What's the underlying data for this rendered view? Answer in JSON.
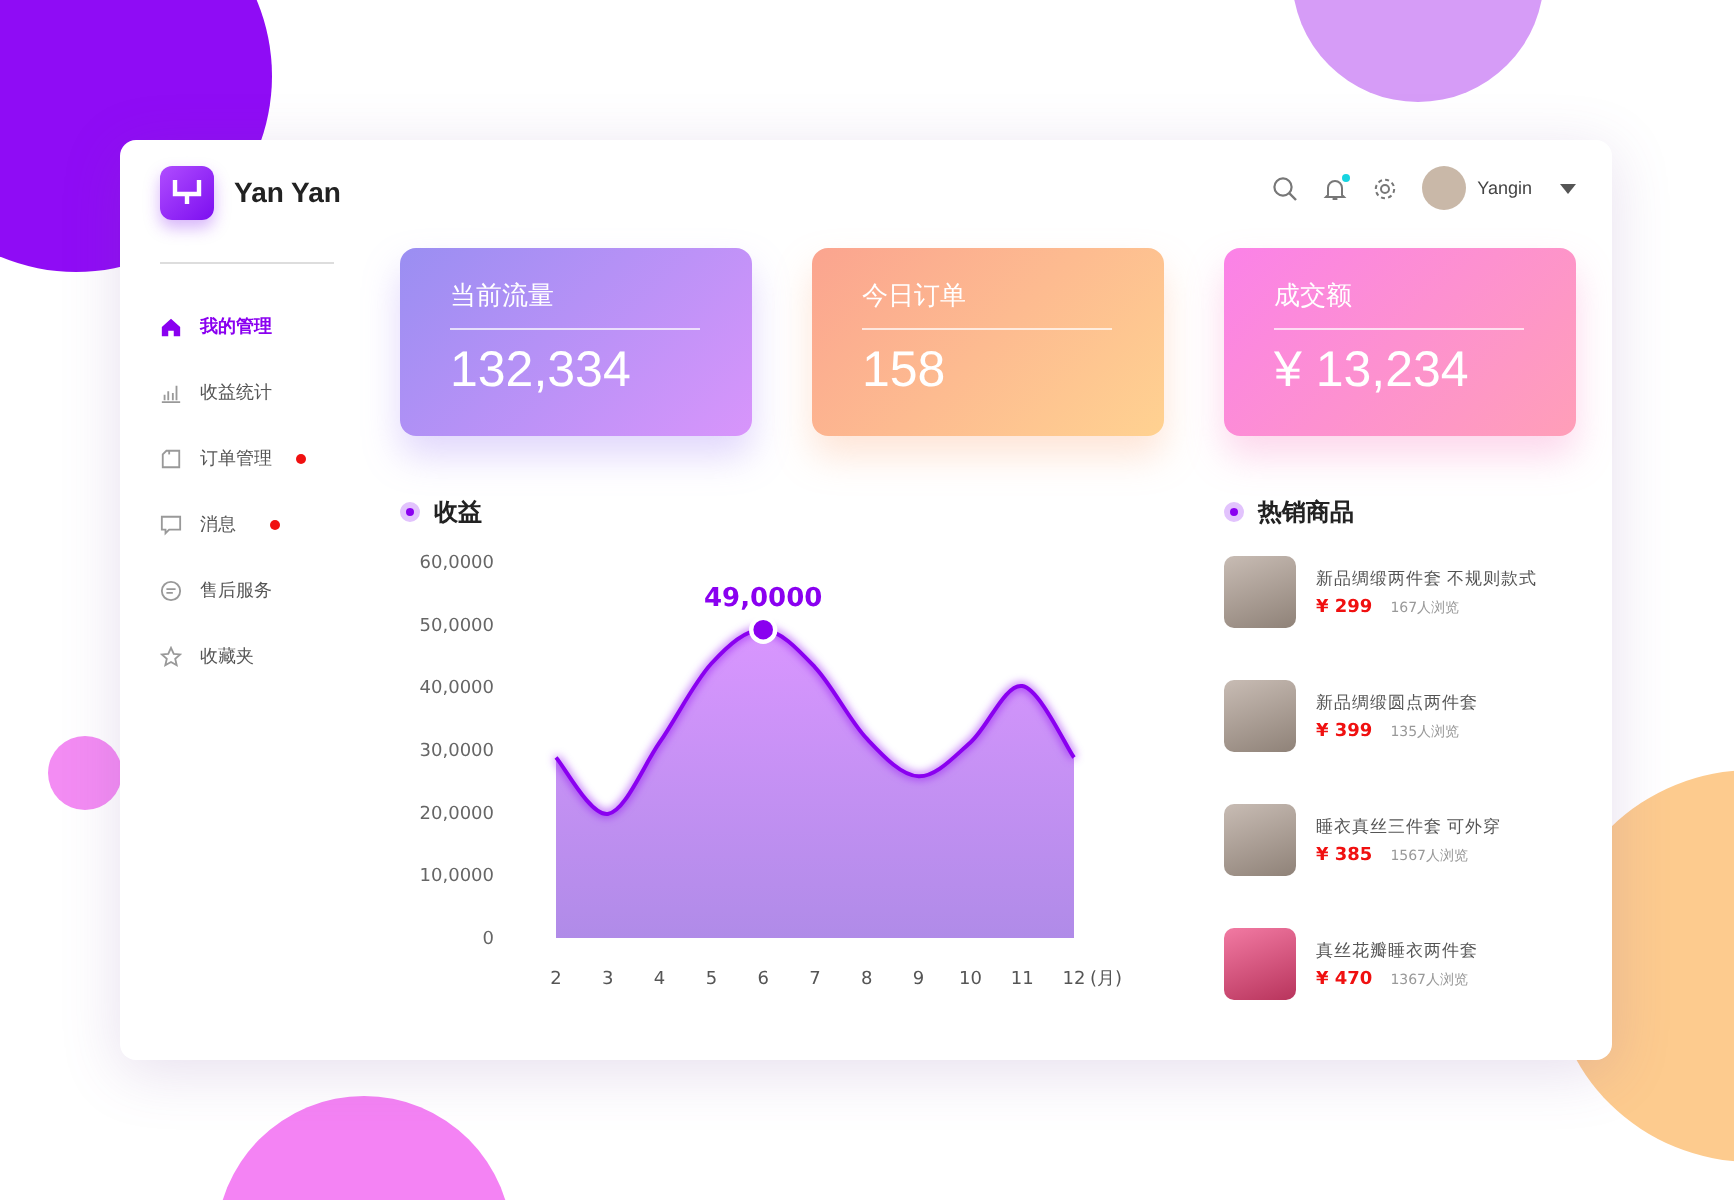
{
  "brand": {
    "name": "Yan Yan"
  },
  "header": {
    "notification_dot": true,
    "user": {
      "name": "Yangin"
    }
  },
  "sidebar": {
    "items": [
      {
        "label": "我的管理",
        "selected": true,
        "badge": false
      },
      {
        "label": "收益统计",
        "selected": false,
        "badge": false
      },
      {
        "label": "订单管理",
        "selected": false,
        "badge": true
      },
      {
        "label": "消息",
        "selected": false,
        "badge": true
      },
      {
        "label": "售后服务",
        "selected": false,
        "badge": false
      },
      {
        "label": "收藏夹",
        "selected": false,
        "badge": false
      }
    ]
  },
  "stats": [
    {
      "title": "当前流量",
      "value": "132,334"
    },
    {
      "title": "今日订单",
      "value": "158"
    },
    {
      "title": "成交额",
      "value": "¥ 13,234"
    }
  ],
  "revenue": {
    "title": "收益",
    "y_axis_labels": [
      "60,0000",
      "50,0000",
      "40,0000",
      "30,0000",
      "20,0000",
      "10,0000",
      "0"
    ],
    "x_axis_labels": [
      "2",
      "3",
      "4",
      "5",
      "6",
      "7",
      "8",
      "9",
      "10",
      "11",
      "12"
    ],
    "x_unit": "(月)",
    "peak_label": "49,0000"
  },
  "hot_products": {
    "title": "热销商品",
    "items": [
      {
        "name": "新品绸缎两件套 不规则款式",
        "price": "¥ 299",
        "views": "167人浏览"
      },
      {
        "name": "新品绸缎圆点两件套",
        "price": "¥ 399",
        "views": "135人浏览"
      },
      {
        "name": "睡衣真丝三件套 可外穿",
        "price": "¥ 385",
        "views": "1567人浏览"
      },
      {
        "name": "真丝花瓣睡衣两件套",
        "price": "¥ 470",
        "views": "1367人浏览"
      }
    ]
  }
}
